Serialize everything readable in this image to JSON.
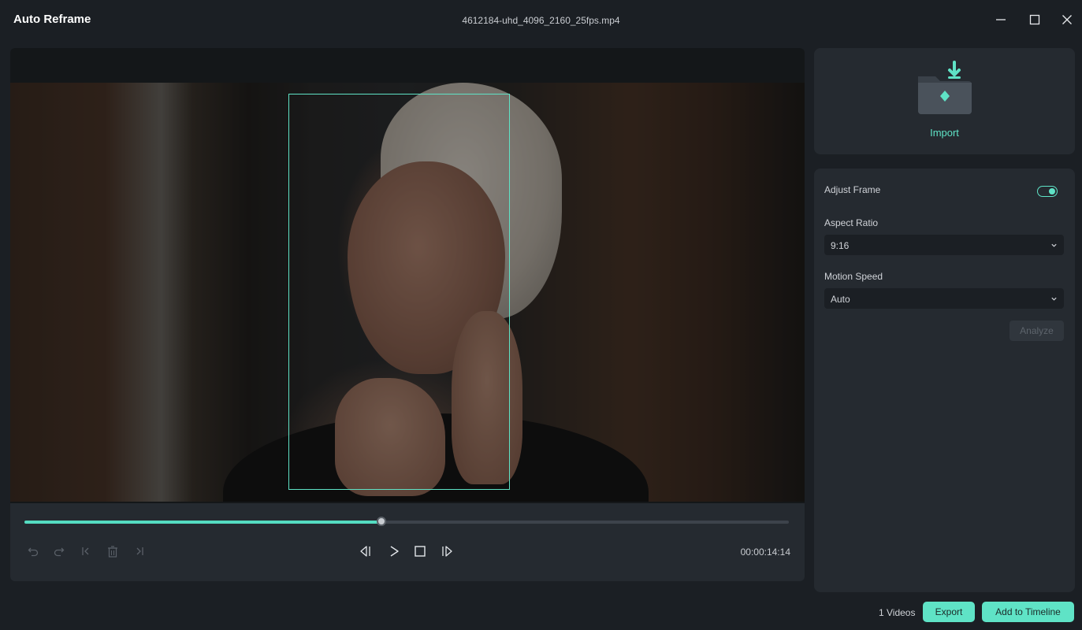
{
  "window": {
    "app_title": "Auto Reframe",
    "file_name": "4612184-uhd_4096_2160_25fps.mp4",
    "controls": [
      "minimize-icon",
      "maximize-icon",
      "close-icon"
    ]
  },
  "player": {
    "timecode": "00:00:14:14",
    "progress": 0.467,
    "controls": [
      "undo-icon",
      "redo-icon",
      "mark-in-icon",
      "delete-icon",
      "mark-out-icon",
      "prev-frame-icon",
      "play-icon",
      "stop-icon",
      "next-frame-icon"
    ]
  },
  "import": {
    "label": "Import"
  },
  "settings": {
    "adjust_frame_label": "Adjust Frame",
    "adjust_frame_on": true,
    "aspect_ratio_label": "Aspect Ratio",
    "aspect_ratio_value": "9:16",
    "motion_speed_label": "Motion Speed",
    "motion_speed_value": "Auto",
    "analyze_label": "Analyze"
  },
  "footer": {
    "count": "1 Videos",
    "export_label": "Export",
    "add_label": "Add to Timeline"
  },
  "colors": {
    "accent": "#5fe3c6",
    "panel": "#252a30",
    "background": "#1b1f24"
  }
}
